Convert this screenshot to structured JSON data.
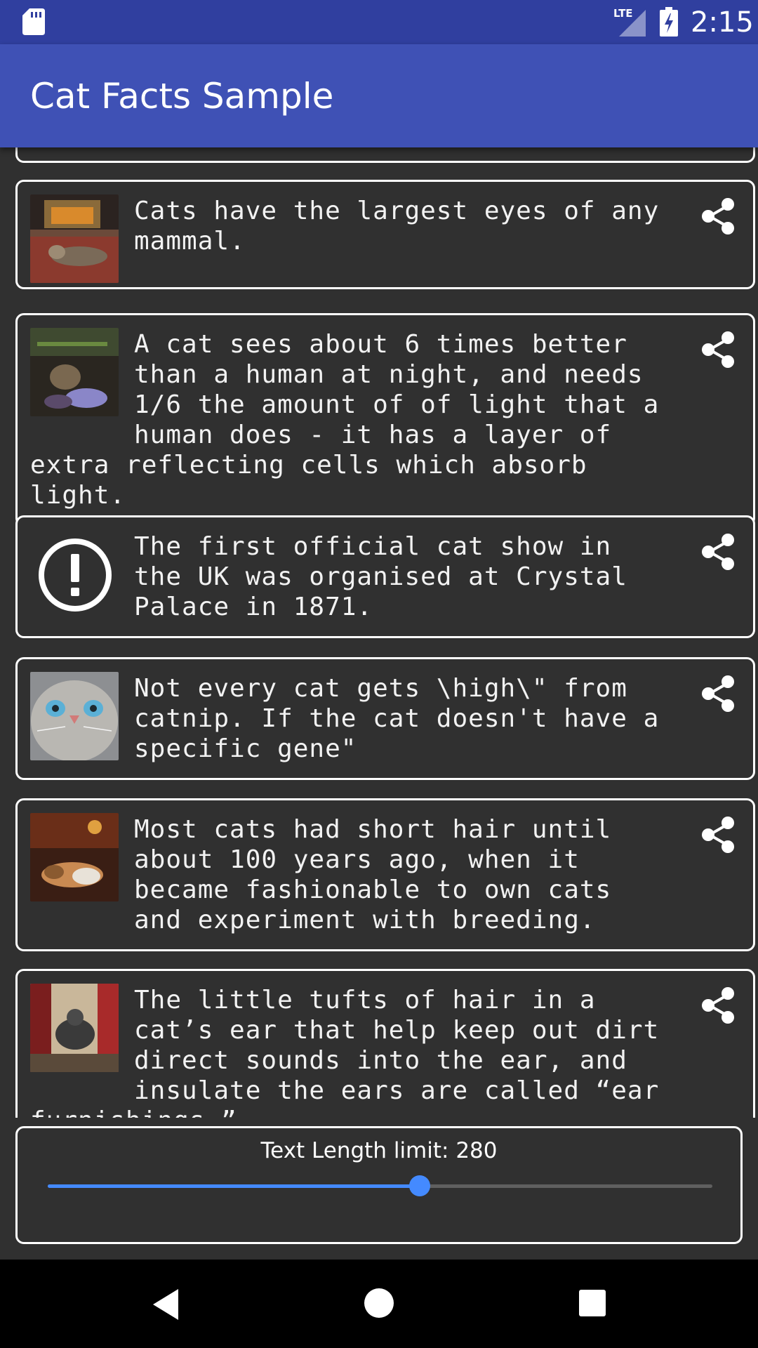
{
  "status_bar": {
    "time": "2:15",
    "network": "LTE",
    "icons": [
      "sd-card-icon",
      "lte-signal-icon",
      "battery-charging-icon"
    ]
  },
  "app_bar": {
    "title": "Cat Facts Sample"
  },
  "facts": [
    {
      "text": "Cats have the largest eyes of any mammal.",
      "thumbnail": "cat-photo"
    },
    {
      "text": "A cat sees about 6 times better than a human at night, and needs 1/6 the amount of of light that a human does - it has a layer of extra reflecting cells which absorb light.",
      "thumbnail": "cat-photo"
    },
    {
      "text": "The first official cat show in the UK was organised at Crystal Palace in 1871.",
      "thumbnail": "alert-icon"
    },
    {
      "text": "Not every cat gets \\high\\\" from catnip. If the cat doesn't have a specific gene\"",
      "thumbnail": "cat-photo"
    },
    {
      "text": "Most cats had short hair until about 100 years ago, when it became fashionable to own cats and experiment with breeding.",
      "thumbnail": "cat-photo"
    },
    {
      "text": "The little tufts of hair in a cat’s ear that help keep out dirt direct sounds into the ear, and insulate the ears are called “ear furnishings.”",
      "thumbnail": "cat-photo"
    }
  ],
  "slider": {
    "label": "Text Length limit: 280",
    "value": 280,
    "fraction": 0.56,
    "accent_color": "#448AFF"
  },
  "nav_bar": {
    "icons": [
      "back-icon",
      "home-icon",
      "recents-icon"
    ]
  },
  "colors": {
    "status_bar": "#303F9F",
    "app_bar": "#3F51B5",
    "background": "#303030"
  }
}
